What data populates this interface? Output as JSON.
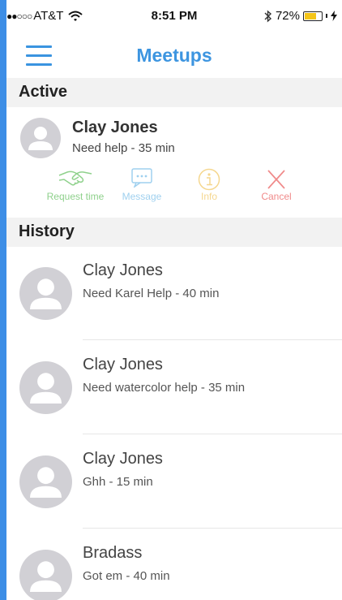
{
  "status_bar": {
    "signal": "●●○○○",
    "carrier": "AT&T",
    "time": "8:51 PM",
    "battery_percent": 72,
    "battery_label": "72%"
  },
  "nav": {
    "title": "Meetups"
  },
  "active": {
    "header": "Active",
    "item": {
      "name": "Clay Jones",
      "subtitle": "Need help - 35 min"
    },
    "actions": [
      {
        "label": "Request time",
        "icon": "handshake-icon",
        "color": "#8fd18c"
      },
      {
        "label": "Message",
        "icon": "message-icon",
        "color": "#9fd0ef"
      },
      {
        "label": "Info",
        "icon": "info-icon",
        "color": "#f5d78f"
      },
      {
        "label": "Cancel",
        "icon": "close-icon",
        "color": "#f08a8a"
      }
    ]
  },
  "history": {
    "header": "History",
    "items": [
      {
        "name": "Clay Jones",
        "subtitle": "Need Karel Help - 40 min"
      },
      {
        "name": "Clay Jones",
        "subtitle": "Need watercolor help - 35 min"
      },
      {
        "name": "Clay Jones",
        "subtitle": "Ghh - 15 min"
      },
      {
        "name": "Bradass",
        "subtitle": "Got em - 40 min"
      }
    ]
  }
}
